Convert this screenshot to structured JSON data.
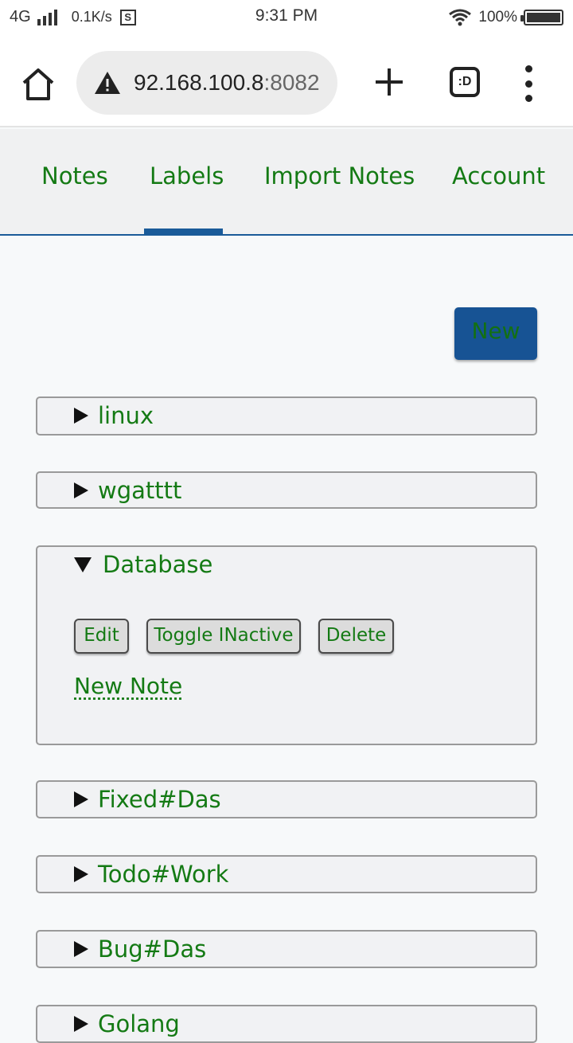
{
  "status_bar": {
    "network": "4G",
    "speed": "0.1K/s",
    "sim_icon_letter": "S",
    "time": "9:31 PM",
    "battery": "100%"
  },
  "browser": {
    "url_host": "92.168.100.8",
    "url_port": ":8082",
    "tab_switcher_label": ":D",
    "icons": [
      "home-icon",
      "warning-icon",
      "plus-icon",
      "tabs-icon",
      "more-vert-icon"
    ]
  },
  "nav": {
    "items": [
      {
        "label": "Notes"
      },
      {
        "label": "Labels"
      },
      {
        "label": "Import Notes"
      },
      {
        "label": "Account"
      }
    ],
    "active": "Labels"
  },
  "new_button_label": "New",
  "labels": [
    {
      "name": "linux",
      "expanded": false
    },
    {
      "name": "wgatttt",
      "expanded": false
    },
    {
      "name": "Database",
      "expanded": true
    },
    {
      "name": "Fixed#Das",
      "expanded": false
    },
    {
      "name": "Todo#Work",
      "expanded": false
    },
    {
      "name": "Bug#Das",
      "expanded": false
    },
    {
      "name": "Golang",
      "expanded": false
    }
  ],
  "expanded_actions": {
    "edit": "Edit",
    "toggle": "Toggle INactive",
    "delete": "Delete",
    "new_note": "New Note"
  },
  "colors": {
    "accent_blue": "#1a5b99",
    "link_green": "#147a14"
  }
}
